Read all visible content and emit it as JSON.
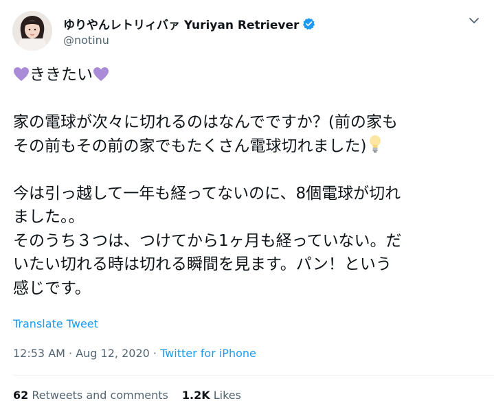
{
  "author": {
    "display_name": "ゆりやんレトリィバァ Yuriyan Retriever",
    "handle": "@notinu",
    "verified_icon": "verified-badge-icon",
    "colors": {
      "verified": "#1d9bf0"
    }
  },
  "tweet": {
    "line1": "ききたい",
    "line2": "家の電球が次々に切れるのはなんでですか？(前の家も",
    "line3": "その前もその前の家でもたくさん電球切れました)",
    "line4": "今は引っ越して一年も経ってないのに、8個電球が切れ",
    "line5": "ました。。",
    "line6": "そのうち３つは、つけてから1ヶ月も経っていない。だ",
    "line7": "いたい切れる時は切れる瞬間を見ます。パン！という",
    "line8": "感じです。",
    "emoji": {
      "heart": "purple-heart-icon",
      "bulb": "light-bulb-icon"
    }
  },
  "translate_label": "Translate Tweet",
  "meta": {
    "time": "12:53 AM",
    "sep1": " · ",
    "date": "Aug 12, 2020",
    "sep2": " · ",
    "source": "Twitter for iPhone"
  },
  "stats": {
    "retweets_count": "62",
    "retweets_label": "Retweets and comments",
    "likes_count": "1.2K",
    "likes_label": "Likes"
  },
  "colors": {
    "text": "#0f1419",
    "secondary": "#536471",
    "link": "#1d9bf0",
    "heart": "#a98bd8"
  }
}
